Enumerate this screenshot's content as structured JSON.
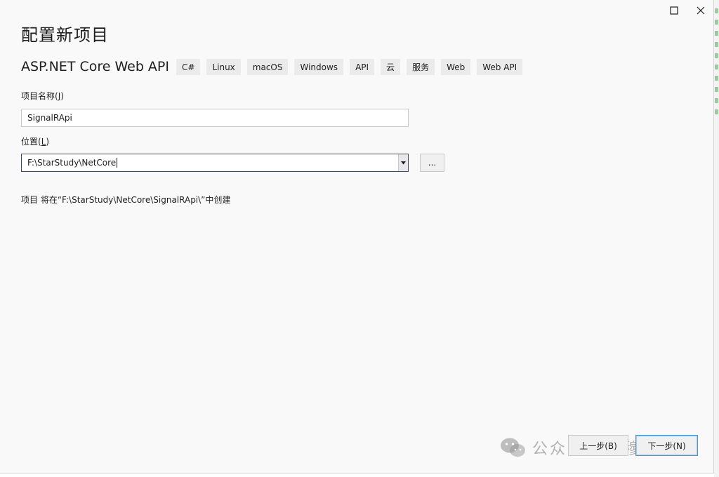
{
  "window": {
    "title": "配置新项目"
  },
  "template": {
    "name": "ASP.NET Core Web API",
    "tags": [
      "C#",
      "Linux",
      "macOS",
      "Windows",
      "API",
      "云",
      "服务",
      "Web",
      "Web API"
    ]
  },
  "project_name": {
    "label": "项目名称",
    "mnemonic": "J",
    "value": "SignalRApi"
  },
  "location": {
    "label": "位置",
    "mnemonic": "L",
    "value": "F:\\StarStudy\\NetCore",
    "browse_label": "..."
  },
  "info_text": "项目 将在“F:\\StarStudy\\NetCore\\SignalRApi\\”中创建",
  "footer": {
    "back_label": "上一步(B)",
    "next_label": "下一步(N)"
  },
  "watermark": {
    "text": "公众号 · 武穆逸仙",
    "icon": "wechat-icon"
  },
  "colors": {
    "dialog_bg": "#f9f9fa",
    "focus_border": "#3399ff",
    "tag_bg": "#ebebeb"
  }
}
